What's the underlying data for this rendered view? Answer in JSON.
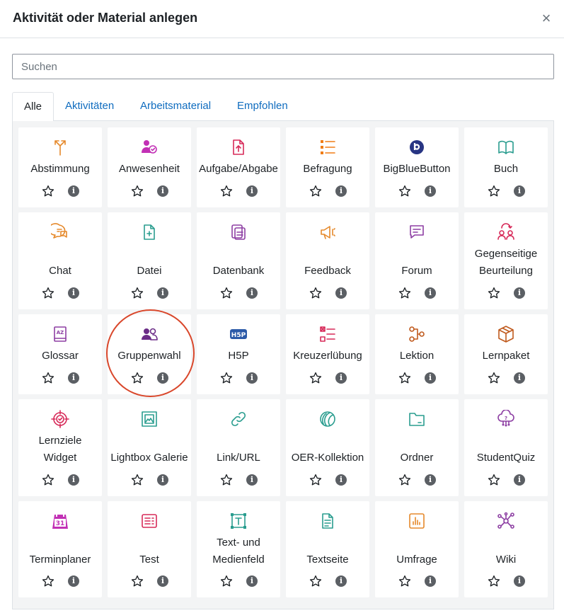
{
  "header": {
    "title": "Aktivität oder Material anlegen",
    "close": "×"
  },
  "search": {
    "placeholder": "Suchen",
    "value": ""
  },
  "tabs": [
    {
      "label": "Alle",
      "active": true
    },
    {
      "label": "Aktivitäten",
      "active": false
    },
    {
      "label": "Arbeitsmaterial",
      "active": false
    },
    {
      "label": "Empfohlen",
      "active": false
    }
  ],
  "info_glyph": "i",
  "rows": [
    [
      {
        "lines": [
          "Abstimmung"
        ],
        "icon": "choice-icon",
        "color": "#e5892b"
      },
      {
        "lines": [
          "Anwesenheit"
        ],
        "icon": "attendance-icon",
        "color": "#c230b5"
      },
      {
        "lines": [
          "Aufgabe/Abgabe"
        ],
        "icon": "assignment-icon",
        "color": "#d72a59"
      },
      {
        "lines": [
          "Befragung"
        ],
        "icon": "feedback-list-icon",
        "color": "#f07d16"
      },
      {
        "lines": [
          "BigBlueButton"
        ],
        "icon": "bigbluebutton-icon",
        "color": "#283583"
      },
      {
        "lines": [
          "Buch"
        ],
        "icon": "book-icon",
        "color": "#2a9d8f"
      }
    ],
    [
      {
        "lines": [
          "Chat"
        ],
        "icon": "chat-icon",
        "color": "#e5892b"
      },
      {
        "lines": [
          "Datei"
        ],
        "icon": "file-icon",
        "color": "#2a9d8f"
      },
      {
        "lines": [
          "Datenbank"
        ],
        "icon": "database-icon",
        "color": "#8d3fa3"
      },
      {
        "lines": [
          "Feedback"
        ],
        "icon": "megaphone-icon",
        "color": "#e5892b"
      },
      {
        "lines": [
          "Forum"
        ],
        "icon": "forum-icon",
        "color": "#8d3fa3"
      },
      {
        "lines": [
          "Gegenseitige",
          "Beurteilung"
        ],
        "icon": "workshop-icon",
        "color": "#d72a59"
      }
    ],
    [
      {
        "lines": [
          "Glossar"
        ],
        "icon": "glossary-icon",
        "color": "#8d3fa3"
      },
      {
        "lines": [
          "Gruppenwahl"
        ],
        "icon": "group-choice-icon",
        "color": "#6b2c87"
      },
      {
        "lines": [
          "H5P"
        ],
        "icon": "h5p-icon",
        "color": "#2b5aa8"
      },
      {
        "lines": [
          "Kreuzerlübung"
        ],
        "icon": "checkmark-list-icon",
        "color": "#d72a59"
      },
      {
        "lines": [
          "Lektion"
        ],
        "icon": "lesson-icon",
        "color": "#c05a1d"
      },
      {
        "lines": [
          "Lernpaket"
        ],
        "icon": "package-icon",
        "color": "#c05a1d"
      }
    ],
    [
      {
        "lines": [
          "Lernziele",
          "Widget"
        ],
        "icon": "target-icon",
        "color": "#d72a59"
      },
      {
        "lines": [
          "Lightbox Galerie"
        ],
        "icon": "gallery-icon",
        "color": "#2a9d8f"
      },
      {
        "lines": [
          "Link/URL"
        ],
        "icon": "link-icon",
        "color": "#2a9d8f"
      },
      {
        "lines": [
          "OER-Kollektion"
        ],
        "icon": "oer-icon",
        "color": "#2a9d8f"
      },
      {
        "lines": [
          "Ordner"
        ],
        "icon": "folder-icon",
        "color": "#2a9d8f"
      },
      {
        "lines": [
          "StudentQuiz"
        ],
        "icon": "studentquiz-icon",
        "color": "#8d3fa3"
      }
    ],
    [
      {
        "lines": [
          "Terminplaner"
        ],
        "icon": "calendar-icon",
        "color": "#c230b5"
      },
      {
        "lines": [
          "Test"
        ],
        "icon": "quiz-icon",
        "color": "#d72a59"
      },
      {
        "lines": [
          "Text- und",
          "Medienfeld"
        ],
        "icon": "text-media-icon",
        "color": "#2a9d8f"
      },
      {
        "lines": [
          "Textseite"
        ],
        "icon": "page-icon",
        "color": "#2a9d8f"
      },
      {
        "lines": [
          "Umfrage"
        ],
        "icon": "survey-icon",
        "color": "#e5892b"
      },
      {
        "lines": [
          "Wiki"
        ],
        "icon": "wiki-icon",
        "color": "#8d3fa3"
      }
    ]
  ]
}
